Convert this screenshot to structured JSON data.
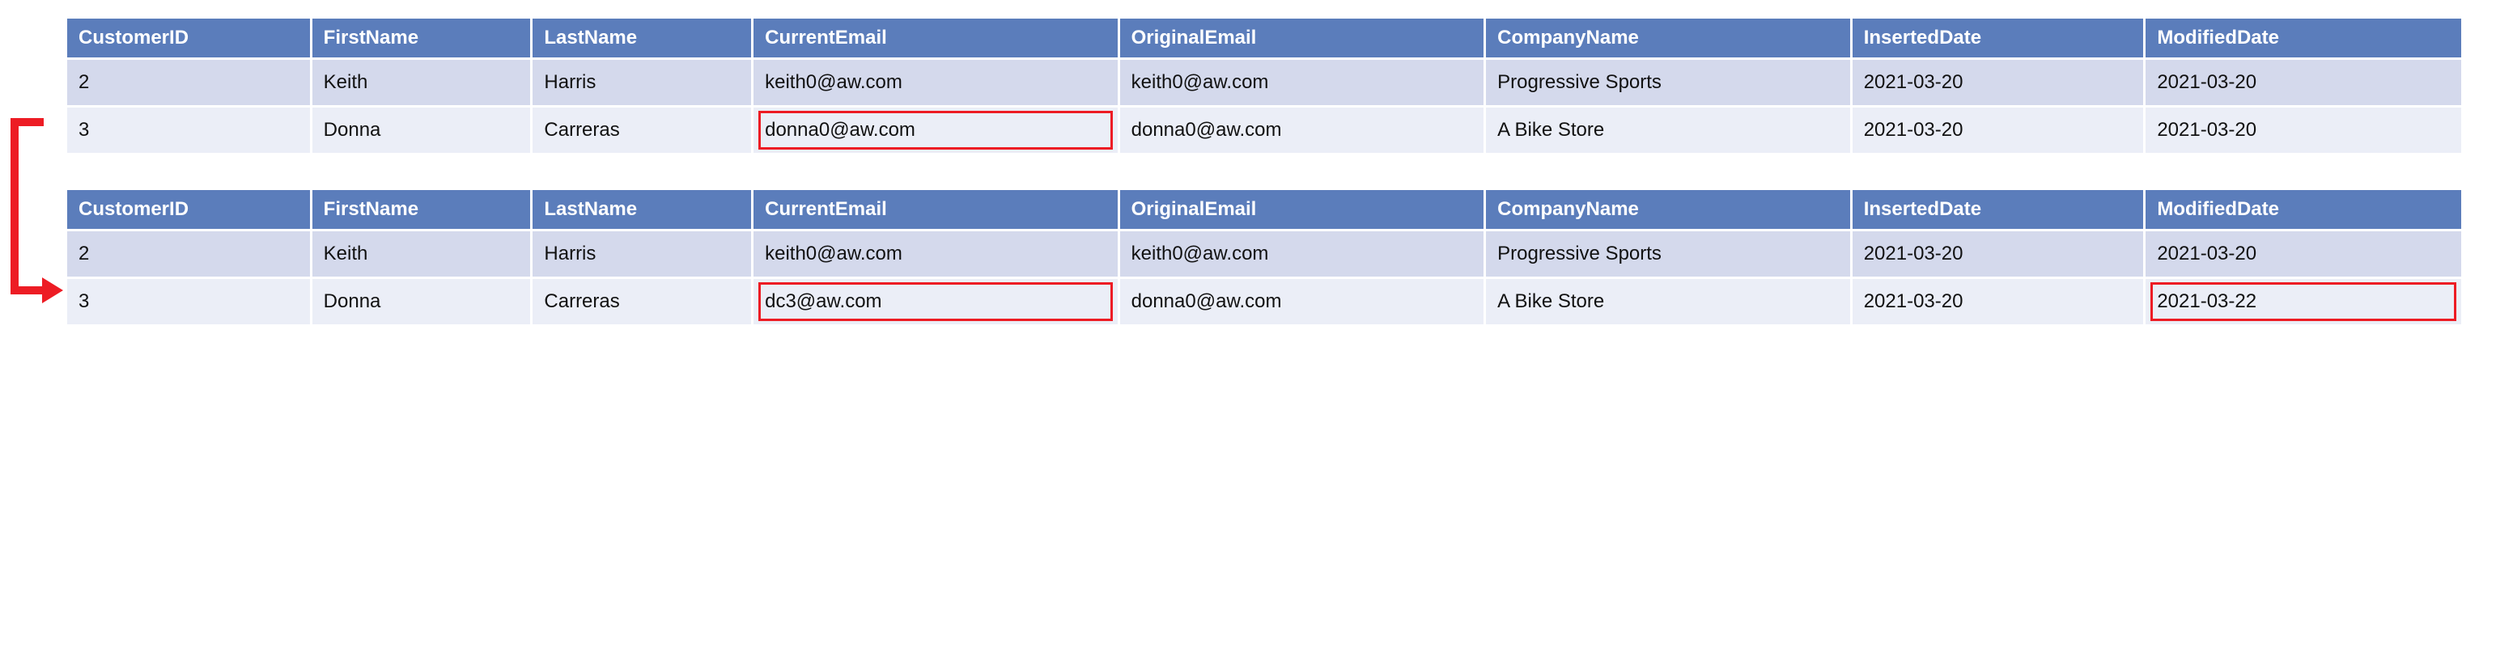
{
  "headers": {
    "customer_id": "CustomerID",
    "first_name": "FirstName",
    "last_name": "LastName",
    "current_email": "CurrentEmail",
    "original_email": "OriginalEmail",
    "company_name": "CompanyName",
    "inserted_date": "InsertedDate",
    "modified_date": "ModifiedDate"
  },
  "table_before": {
    "rows": [
      {
        "customer_id": "2",
        "first_name": "Keith",
        "last_name": "Harris",
        "current_email": "keith0@aw.com",
        "original_email": "keith0@aw.com",
        "company_name": "Progressive Sports",
        "inserted_date": "2021-03-20",
        "modified_date": "2021-03-20",
        "highlight_current_email": false,
        "highlight_modified_date": false
      },
      {
        "customer_id": "3",
        "first_name": "Donna",
        "last_name": "Carreras",
        "current_email": "donna0@aw.com",
        "original_email": "donna0@aw.com",
        "company_name": "A Bike Store",
        "inserted_date": "2021-03-20",
        "modified_date": "2021-03-20",
        "highlight_current_email": true,
        "highlight_modified_date": false
      }
    ]
  },
  "table_after": {
    "rows": [
      {
        "customer_id": "2",
        "first_name": "Keith",
        "last_name": "Harris",
        "current_email": "keith0@aw.com",
        "original_email": "keith0@aw.com",
        "company_name": "Progressive Sports",
        "inserted_date": "2021-03-20",
        "modified_date": "2021-03-20",
        "highlight_current_email": false,
        "highlight_modified_date": false
      },
      {
        "customer_id": "3",
        "first_name": "Donna",
        "last_name": "Carreras",
        "current_email": "dc3@aw.com",
        "original_email": "donna0@aw.com",
        "company_name": "A Bike Store",
        "inserted_date": "2021-03-20",
        "modified_date": "2021-03-22",
        "highlight_current_email": true,
        "highlight_modified_date": true
      }
    ]
  }
}
